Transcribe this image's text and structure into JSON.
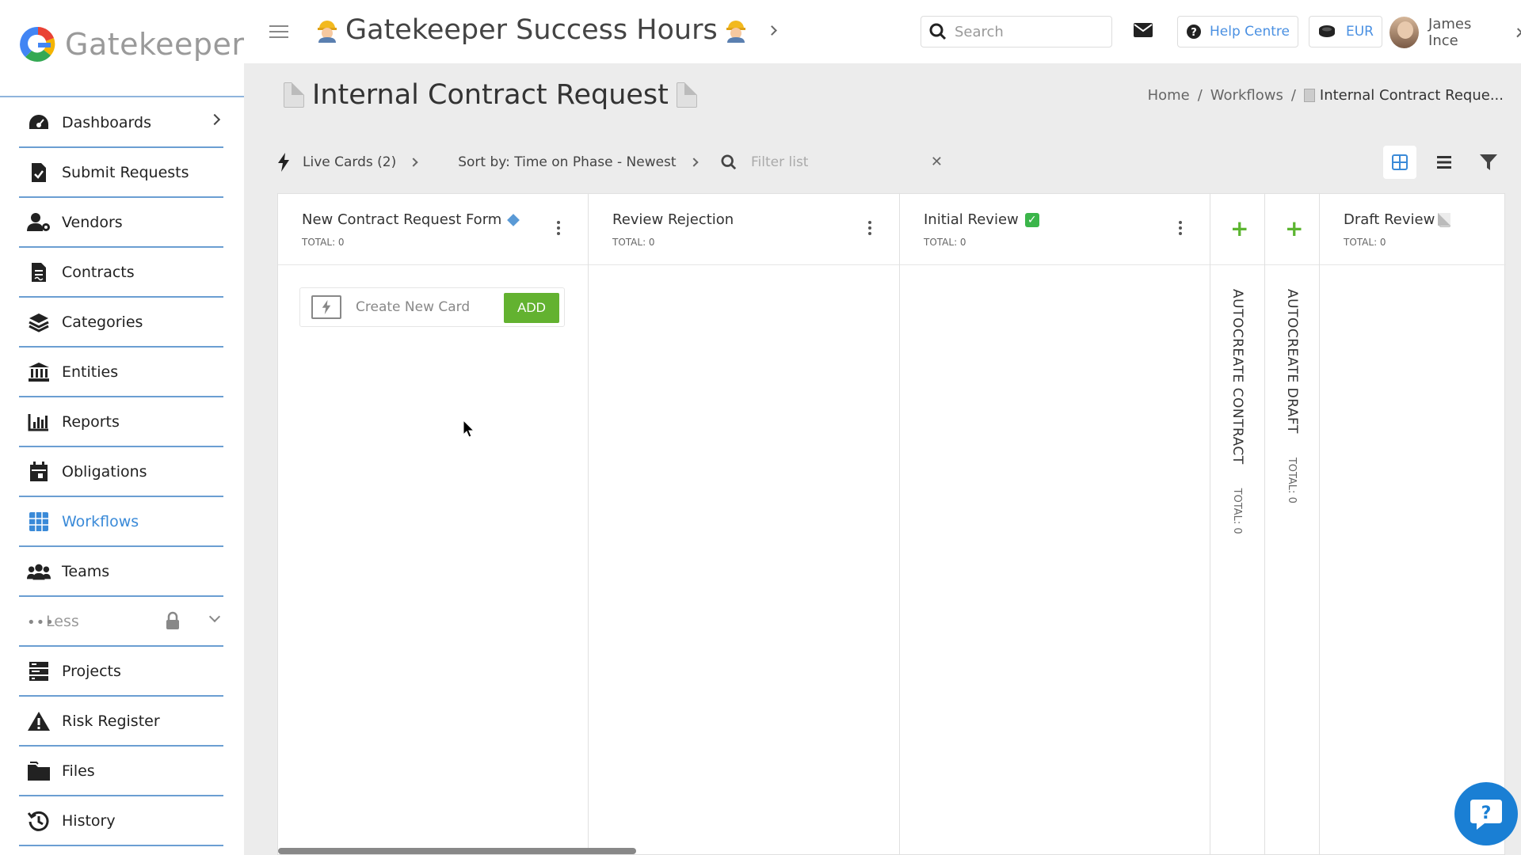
{
  "app": {
    "logo_text": "Gatekeeper",
    "site_title": "Gatekeeper Success Hours"
  },
  "header": {
    "search_placeholder": "Search",
    "help_label": "Help Centre",
    "currency": "EUR",
    "user_name": "James Ince"
  },
  "sidebar": {
    "items": [
      {
        "label": "Dashboards",
        "icon": "dashboard-icon",
        "has_chevron": true
      },
      {
        "label": "Submit Requests",
        "icon": "file-check-icon"
      },
      {
        "label": "Vendors",
        "icon": "vendor-icon"
      },
      {
        "label": "Contracts",
        "icon": "contract-icon"
      },
      {
        "label": "Categories",
        "icon": "layers-icon"
      },
      {
        "label": "Entities",
        "icon": "bank-icon"
      },
      {
        "label": "Reports",
        "icon": "bar-chart-icon"
      },
      {
        "label": "Obligations",
        "icon": "calendar-icon"
      },
      {
        "label": "Workflows",
        "icon": "grid-icon",
        "active": true
      },
      {
        "label": "Teams",
        "icon": "users-icon"
      },
      {
        "label": "Less",
        "icon": "more-icon"
      },
      {
        "label": "Projects",
        "icon": "projects-icon"
      },
      {
        "label": "Risk Register",
        "icon": "warning-icon"
      },
      {
        "label": "Files",
        "icon": "folder-icon"
      },
      {
        "label": "History",
        "icon": "history-icon"
      }
    ]
  },
  "page": {
    "title": "Internal Contract Request",
    "breadcrumb": [
      "Home",
      "Workflows",
      "Internal Contract Reque..."
    ]
  },
  "toolbar": {
    "live_cards": "Live Cards (2)",
    "sort": "Sort by: Time on Phase - Newest",
    "filter_placeholder": "Filter list"
  },
  "board": {
    "columns": [
      {
        "title": "New Contract Request Form",
        "total": "TOTAL: 0"
      },
      {
        "title": "Review Rejection",
        "total": "TOTAL: 0"
      },
      {
        "title": "Initial Review",
        "total": "TOTAL: 0"
      },
      {
        "title": "AUTOCREATE CONTRACT",
        "total": "TOTAL: 0"
      },
      {
        "title": "AUTOCREATE DRAFT",
        "total": "TOTAL: 0"
      },
      {
        "title": "Draft Review",
        "total": "TOTAL: 0"
      }
    ],
    "create_card_label": "Create New Card",
    "add_label": "ADD"
  },
  "colors": {
    "accent": "#3a8ad8",
    "success": "#63b230",
    "divider": "#6b9ed2"
  }
}
